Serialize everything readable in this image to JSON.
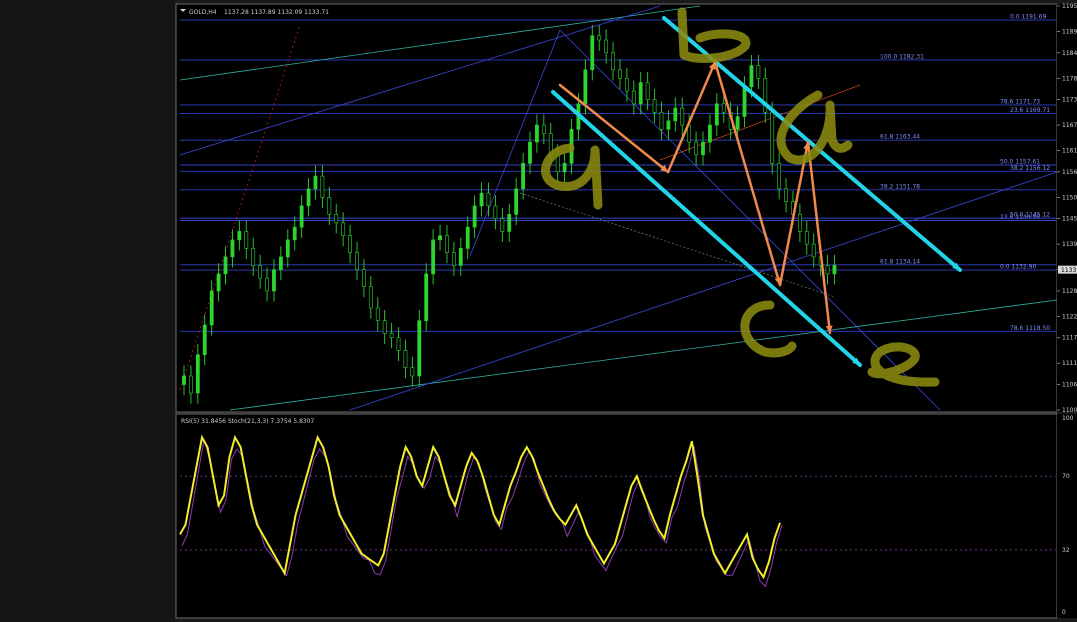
{
  "chart_data": [
    {
      "type": "candlestick",
      "symbol_label": "GOLD,H4",
      "ohlc_header": "1137.28 1137.89 1132.09 1133.71",
      "current_price": "1133",
      "ylim": [
        1100,
        1195
      ],
      "y_ticks": [
        "1195",
        "1189",
        "1184",
        "1178",
        "1173",
        "1167",
        "1161",
        "1156",
        "1150",
        "1145",
        "1139",
        "1133",
        "1128",
        "1122",
        "1117",
        "1111",
        "1106",
        "1100"
      ],
      "close_series": [
        1108,
        1104,
        1113,
        1120,
        1128,
        1132,
        1136,
        1140,
        1142,
        1138,
        1134,
        1131,
        1128,
        1133,
        1136,
        1140,
        1143,
        1148,
        1152,
        1155,
        1150,
        1146,
        1144,
        1141,
        1137,
        1133,
        1129,
        1124,
        1121,
        1118,
        1117,
        1114,
        1110,
        1108,
        1121,
        1132,
        1140,
        1141,
        1137,
        1134,
        1138,
        1143,
        1148,
        1151,
        1148,
        1145,
        1142,
        1146,
        1152,
        1158,
        1163,
        1167,
        1165,
        1160,
        1156,
        1158,
        1166,
        1172,
        1180,
        1188,
        1187,
        1184,
        1180,
        1178,
        1175,
        1172,
        1177,
        1173,
        1170,
        1166,
        1168,
        1171,
        1167,
        1163,
        1160,
        1163,
        1167,
        1172,
        1170,
        1166,
        1169,
        1176,
        1181,
        1178,
        1170,
        1158,
        1152,
        1149,
        1146,
        1142,
        1139,
        1136,
        1134,
        1132,
        1134
      ],
      "fib_levels": [
        {
          "label": "0.0  1191.69",
          "price": 1191.69
        },
        {
          "label": "100.0  1182.31",
          "price": 1182.31
        },
        {
          "label": "78.6  1171.73",
          "price": 1171.73
        },
        {
          "label": "23.6  1169.71",
          "price": 1169.71
        },
        {
          "label": "61.8  1163.44",
          "price": 1163.44
        },
        {
          "label": "50.0  1157.61",
          "price": 1157.61
        },
        {
          "label": "38.2  1156.12",
          "price": 1156.12
        },
        {
          "label": "38.2  1151.78",
          "price": 1151.78
        },
        {
          "label": "23.6  1144.56",
          "price": 1144.56
        },
        {
          "label": "50.0  1145.12",
          "price": 1145.12
        },
        {
          "label": "61.8  1134.14",
          "price": 1134.14
        },
        {
          "label": "0.0  1132.90",
          "price": 1132.9
        },
        {
          "label": "78.6  1118.50",
          "price": 1118.5
        }
      ],
      "annotations": [
        "a",
        "b",
        "c",
        "d",
        "e"
      ]
    },
    {
      "type": "line",
      "label": "RSI(5) 31.8456  Stoch(21,3,3) 7.3754 5.8307",
      "ylim": [
        0,
        100
      ],
      "y_ticks": [
        "100",
        "70",
        "32",
        "0"
      ],
      "series": [
        {
          "values": [
            40,
            45,
            60,
            75,
            90,
            85,
            70,
            55,
            60,
            80,
            90,
            85,
            70,
            55,
            45,
            40,
            35,
            30,
            25,
            20,
            35,
            50,
            60,
            70,
            80,
            90,
            85,
            75,
            60,
            50,
            45,
            40,
            35,
            30,
            28,
            26,
            24,
            30,
            45,
            60,
            75,
            85,
            80,
            70,
            65,
            75,
            85,
            80,
            70,
            60,
            55,
            65,
            75,
            82,
            78,
            70,
            60,
            50,
            45,
            55,
            65,
            72,
            80,
            85,
            80,
            72,
            65,
            58,
            52,
            48,
            45,
            50,
            55,
            48,
            40,
            35,
            30,
            25,
            30,
            35,
            45,
            55,
            65,
            70,
            62,
            55,
            48,
            42,
            38,
            50,
            60,
            70,
            78,
            88,
            70,
            50,
            40,
            30,
            25,
            20,
            25,
            30,
            35,
            40,
            28,
            22,
            18,
            26,
            38,
            46
          ]
        }
      ]
    }
  ]
}
